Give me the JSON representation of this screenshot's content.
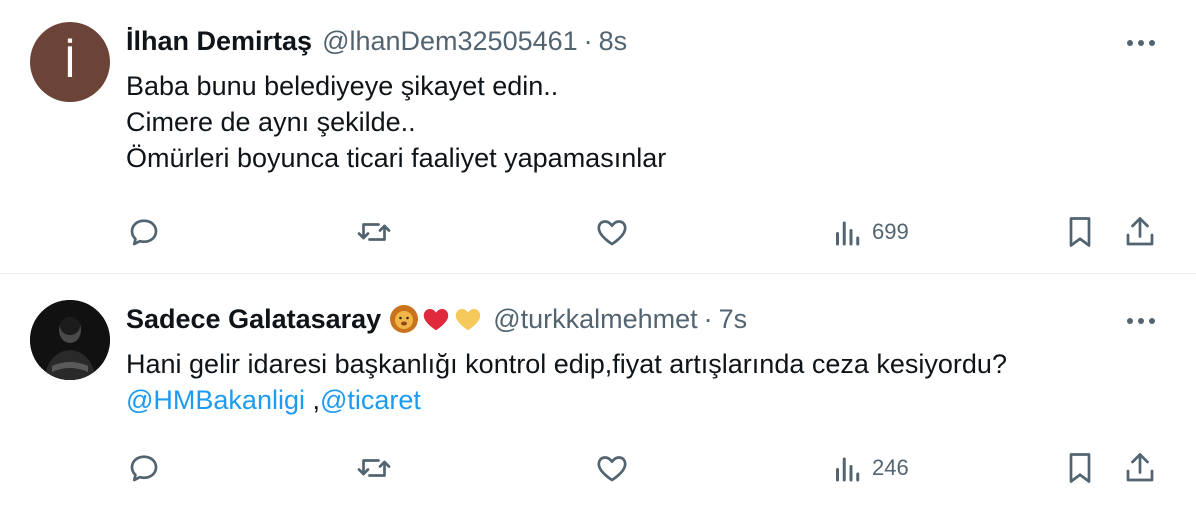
{
  "tweets": [
    {
      "name": "İlhan Demirtaş",
      "handle": "@lhanDem32505461",
      "separator": "·",
      "time": "8s",
      "avatar_initial": "İ",
      "lines": [
        "Baba bunu belediyeye şikayet edin..",
        "Cimere de aynı şekilde..",
        "Ömürleri boyunca ticari faaliyet yapamasınlar"
      ],
      "views": "699"
    },
    {
      "name": "Sadece Galatasaray",
      "handle": "@turkkalmehmet",
      "separator": "·",
      "time": "7s",
      "lines": [
        "Hani gelir idaresi başkanlığı kontrol edip,fiyat artışlarında ceza kesiyordu?"
      ],
      "mention1": "@HMBakanligi",
      "mention_sep": " ,",
      "mention2": "@ticaret",
      "views": "246"
    }
  ],
  "colors": {
    "text": "#0f1419",
    "secondary": "#536471",
    "link": "#1d9bf0",
    "divider": "#e6ecf0",
    "avatar1": "#6b4337"
  },
  "icons": [
    "more-icon",
    "reply-icon",
    "retweet-icon",
    "like-icon",
    "views-icon",
    "bookmark-icon",
    "share-icon",
    "lion-emoji",
    "red-heart-emoji",
    "yellow-heart-emoji"
  ]
}
